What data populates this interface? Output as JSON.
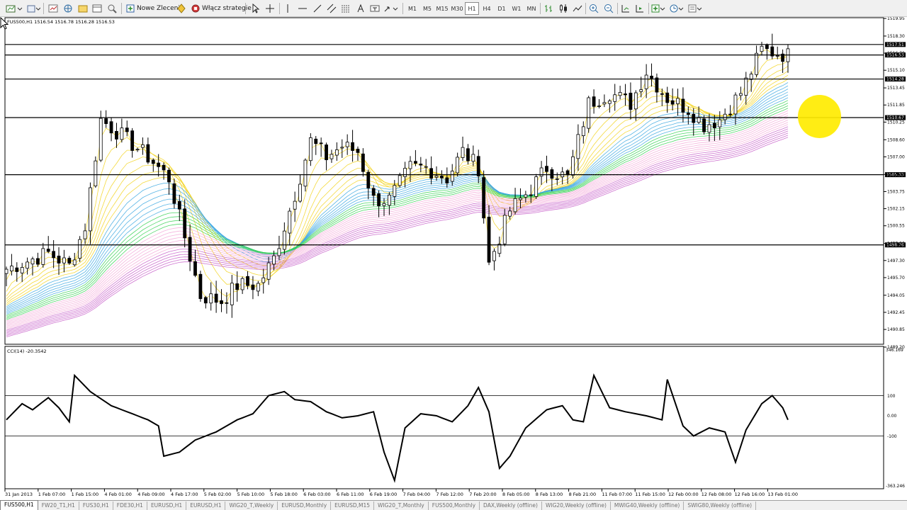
{
  "toolbar": {
    "new_order": "Nowe Zlecenie",
    "strategies": "Włącz strategie",
    "timeframes": [
      "M1",
      "M5",
      "M15",
      "M30",
      "H1",
      "H4",
      "D1",
      "W1",
      "MN"
    ],
    "active_timeframe": "H1",
    "icons": [
      "new-chart-icon",
      "profiles-icon",
      "market-watch-icon",
      "data-window-icon",
      "navigator-icon",
      "terminal-icon",
      "strategy-tester-icon",
      "new-order-icon",
      "metaeditor-icon",
      "autotrading-icon",
      "cursor-icon",
      "crosshair-icon",
      "vertical-line-icon",
      "horizontal-line-icon",
      "trendline-icon",
      "equidistant-channel-icon",
      "fibonacci-icon",
      "text-icon",
      "text-label-icon",
      "arrows-icon",
      "bar-chart-icon",
      "candlesticks-icon",
      "line-chart-icon",
      "zoom-in-icon",
      "zoom-out-icon",
      "chart-shift-icon",
      "autoscroll-icon",
      "indicators-icon",
      "periods-icon",
      "templates-icon"
    ]
  },
  "chart": {
    "header": "FUS500,H1  1516.54 1516.78 1516.28 1516.53",
    "price_axis": [
      "1519.95",
      "1518.30",
      "1516.70",
      "1515.10",
      "1513.45",
      "1511.85",
      "1510.25",
      "1508.60",
      "1507.00",
      "1505.35",
      "1503.75",
      "1502.15",
      "1500.55",
      "1498.90",
      "1497.30",
      "1495.70",
      "1494.05",
      "1492.45",
      "1490.85",
      "1489.20"
    ],
    "horizontal_lines": [
      {
        "price": "1517.51",
        "style": "black"
      },
      {
        "price": "1516.53",
        "style": "black"
      },
      {
        "price": "1514.28",
        "style": "black"
      },
      {
        "price": "1510.67",
        "style": "black"
      },
      {
        "price": "1505.33",
        "style": "black"
      },
      {
        "price": "1498.76",
        "style": "black"
      }
    ],
    "indicator_header": "CCI(14) -20.3542",
    "indicator_axis": {
      "top": "346.169",
      "upper": "100",
      "zero": "0.00",
      "lower": "-100",
      "bottom": "-363.246"
    },
    "time_axis": [
      "31 Jan 2013",
      "1 Feb 07:00",
      "1 Feb 15:00",
      "4 Feb 01:00",
      "4 Feb 09:00",
      "4 Feb 17:00",
      "5 Feb 02:00",
      "5 Feb 10:00",
      "5 Feb 18:00",
      "6 Feb 03:00",
      "6 Feb 11:00",
      "6 Feb 19:00",
      "7 Feb 04:00",
      "7 Feb 12:00",
      "7 Feb 20:00",
      "8 Feb 05:00",
      "8 Feb 13:00",
      "8 Feb 21:00",
      "11 Feb 07:00",
      "11 Feb 15:00",
      "12 Feb 00:00",
      "12 Feb 08:00",
      "12 Feb 16:00",
      "13 Feb 01:00"
    ]
  },
  "tabs": [
    "FUS500,H1",
    "FW20_T1,H1",
    "FUS30,H1",
    "FDE30,H1",
    "EURUSD,H1",
    "EURUSD,H1",
    "WIG20_T,Weekly",
    "EURUSD,Monthly",
    "EURUSD,M15",
    "WIG20_T,Monthly",
    "FUS500,Monthly",
    "DAX,Weekly (offline)",
    "WIG20,Weekly (offline)",
    "MWIG40,Weekly (offline)",
    "SWIG80,Weekly (offline)"
  ],
  "active_tab": "FUS500,H1",
  "colors": {
    "bull_candle": "#ffffff",
    "bear_candle": "#000000",
    "ribbon_yellow": "#f2d21a",
    "ribbon_blue": "#3aa7e0",
    "ribbon_green": "#32d050",
    "ribbon_pink": "#f3a8d8",
    "ribbon_purple": "#c55ac8",
    "price_tag": "#000000",
    "highlight": "#ffea00"
  }
}
